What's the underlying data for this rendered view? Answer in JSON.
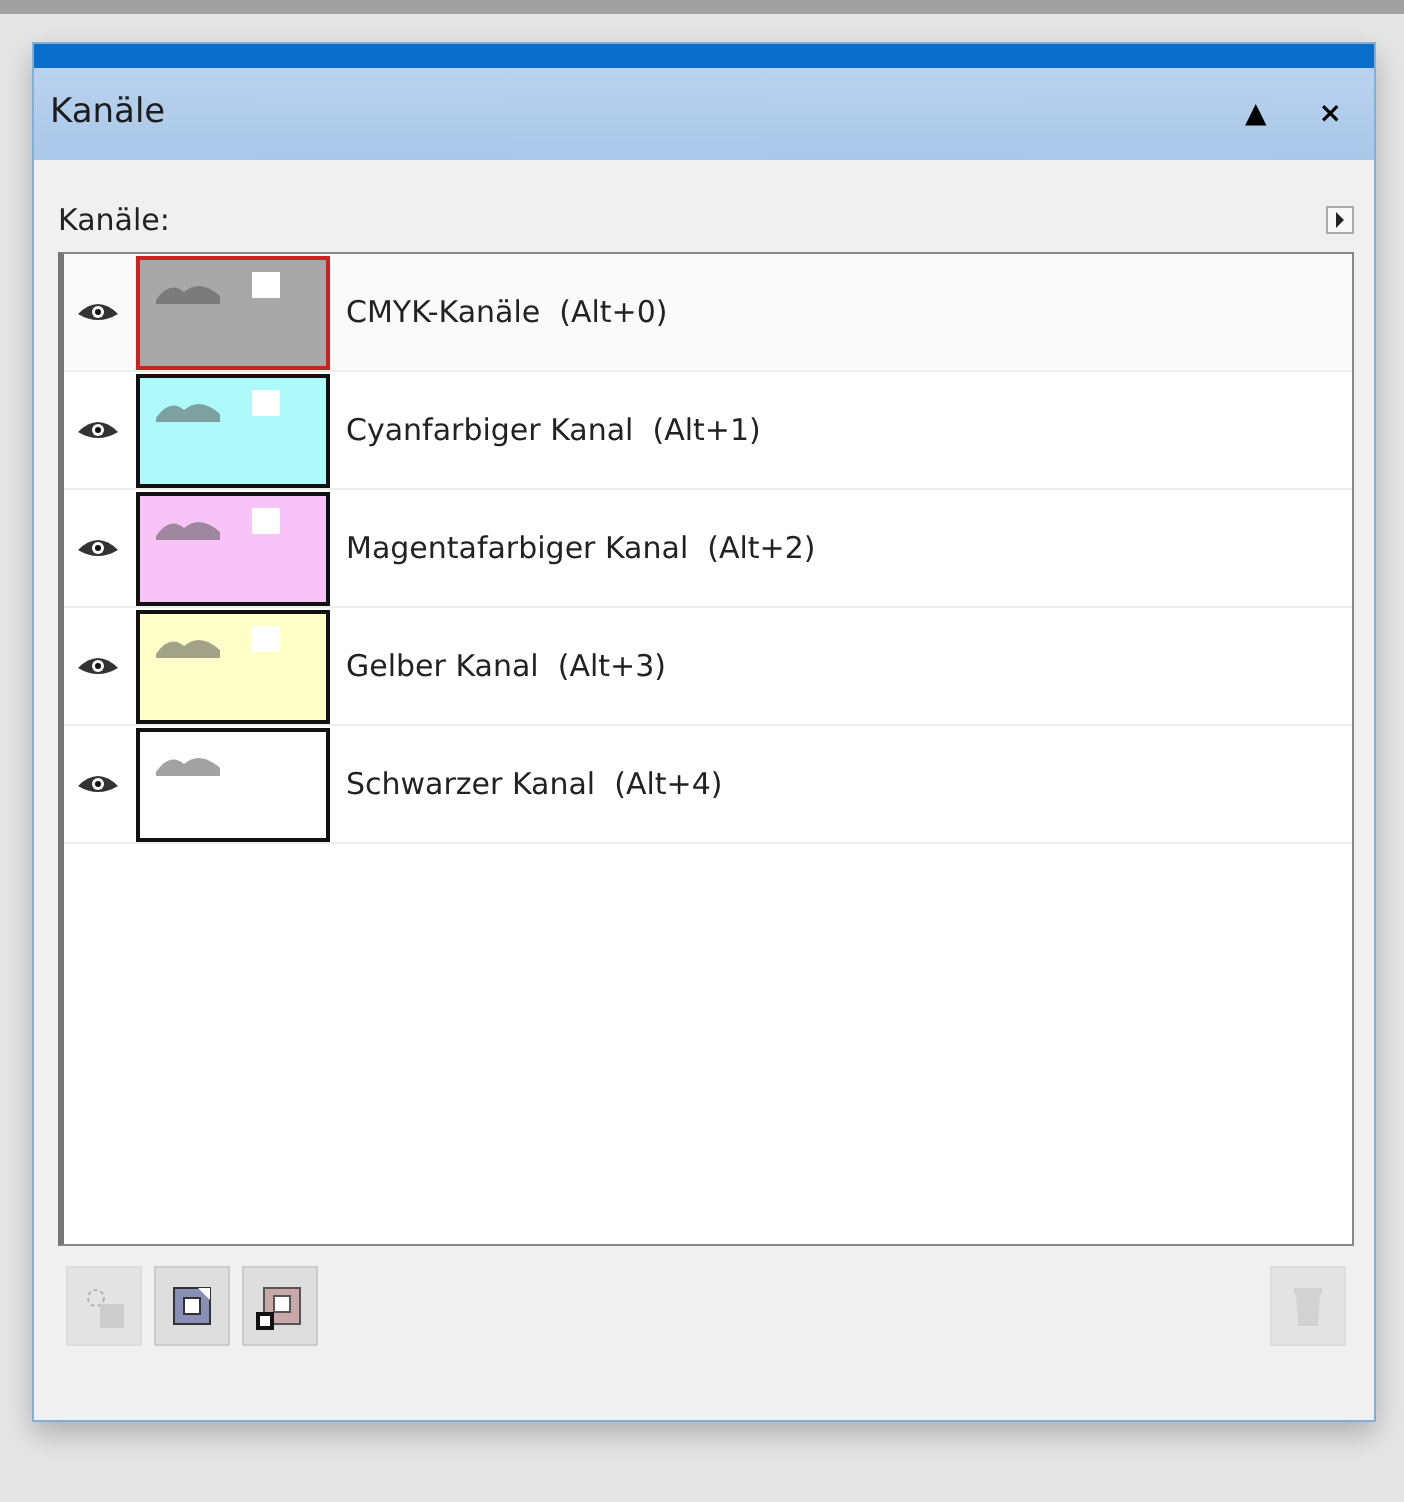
{
  "window": {
    "title": "Kanäle",
    "collapse_glyph": "▲",
    "close_glyph": "×"
  },
  "panel": {
    "label": "Kanäle:"
  },
  "channels": [
    {
      "name": "CMYK-Kanäle  (Alt+0)",
      "visible": true,
      "selected": true,
      "color": "#a8a8a8"
    },
    {
      "name": "Cyanfarbiger Kanal  (Alt+1)",
      "visible": true,
      "selected": false,
      "color": "#aefafa"
    },
    {
      "name": "Magentafarbiger Kanal  (Alt+2)",
      "visible": true,
      "selected": false,
      "color": "#f8c4f8"
    },
    {
      "name": "Gelber Kanal  (Alt+3)",
      "visible": true,
      "selected": false,
      "color": "#ffffc8"
    },
    {
      "name": "Schwarzer Kanal  (Alt+4)",
      "visible": true,
      "selected": false,
      "color": "#ffffff"
    }
  ],
  "toolbar": [
    {
      "kind": "load-selection",
      "disabled": true
    },
    {
      "kind": "save-selection",
      "disabled": false
    },
    {
      "kind": "new-channel",
      "disabled": false
    },
    {
      "kind": "delete",
      "disabled": true
    }
  ]
}
